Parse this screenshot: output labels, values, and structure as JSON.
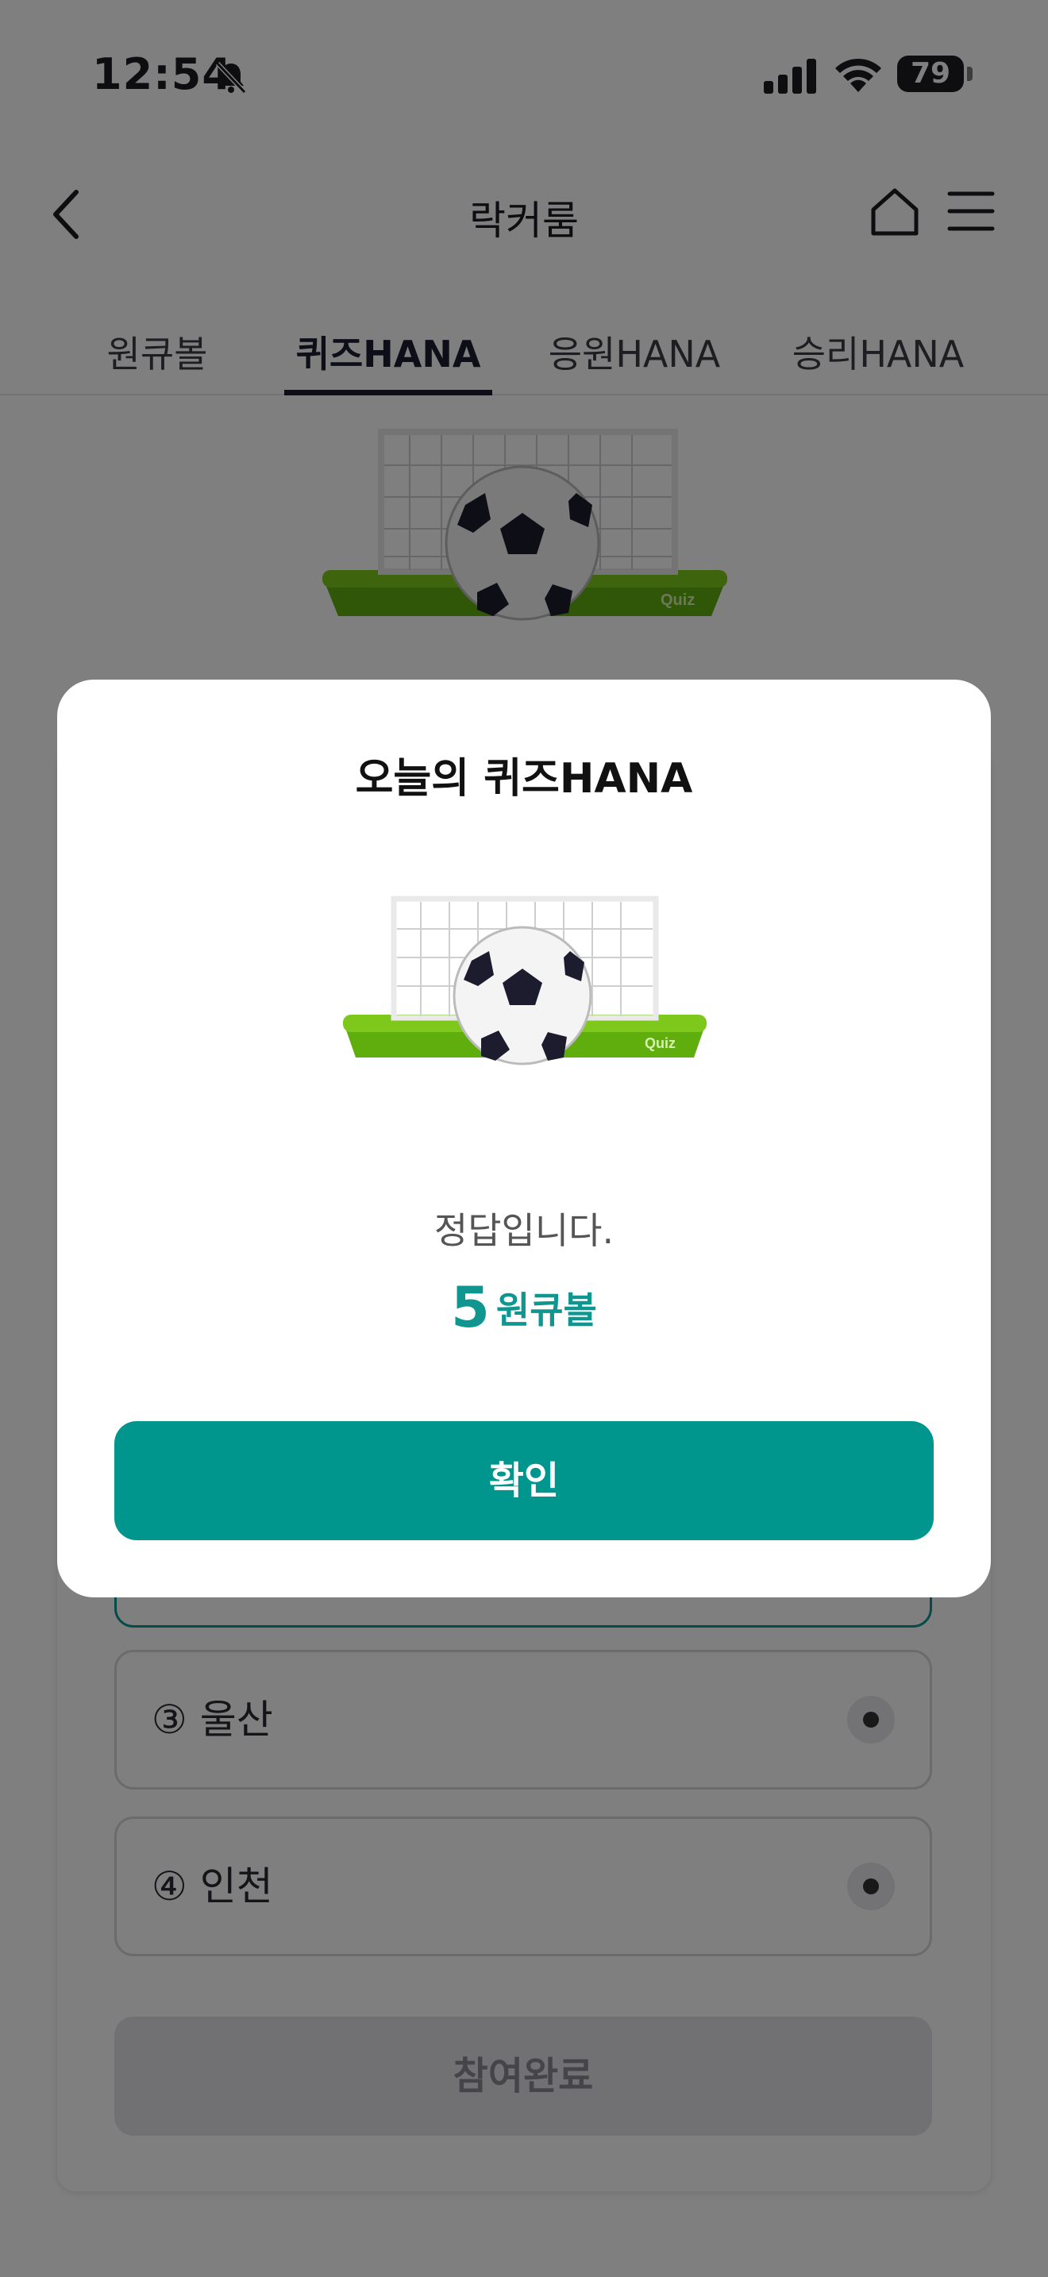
{
  "status_bar": {
    "time": "12:54",
    "battery": "79",
    "icons": [
      "bell-slash-icon",
      "cellular-signal-icon",
      "wifi-icon",
      "battery-icon"
    ]
  },
  "nav": {
    "title": "락커룸",
    "icons": [
      "chevron-left-icon",
      "home-icon",
      "hamburger-menu-icon"
    ]
  },
  "tabs": [
    {
      "label": "원큐볼",
      "active": false
    },
    {
      "label": "퀴즈HANA",
      "active": true
    },
    {
      "label": "응원HANA",
      "active": false
    },
    {
      "label": "승리HANA",
      "active": false
    }
  ],
  "quiz": {
    "options": [
      {
        "label": "③ 울산"
      },
      {
        "label": "④ 인천"
      }
    ],
    "submit_label": "참여완료",
    "image_caption": "Quiz"
  },
  "modal": {
    "title": "오늘의 퀴즈HANA",
    "message": "정답입니다.",
    "reward_amount": "5",
    "reward_unit": "원큐볼",
    "confirm_label": "확인",
    "image_caption": "Quiz"
  },
  "colors": {
    "accent": "#00968e",
    "text_dark": "#1c1c30",
    "overlay": "rgba(0,0,0,0.5)"
  }
}
